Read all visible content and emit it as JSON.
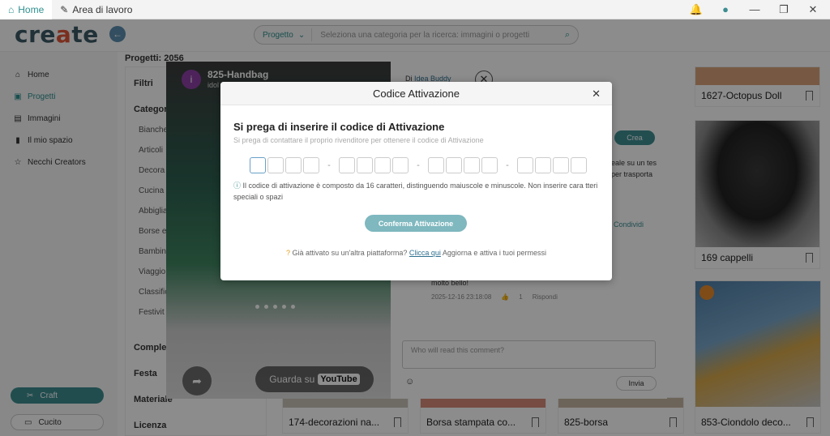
{
  "titlebar": {
    "tab_home": "Home",
    "tab_workspace": "Area di lavoro"
  },
  "header": {
    "logo_main": "cre",
    "logo_accent": "a",
    "logo_end": "te",
    "search_category": "Progetto",
    "search_placeholder": "Seleziona una categoria per la ricerca: immagini o progetti"
  },
  "sidebar": {
    "items": [
      {
        "label": "Home",
        "icon": "home-icon"
      },
      {
        "label": "Progetti",
        "icon": "projects-icon"
      },
      {
        "label": "Immagini",
        "icon": "images-icon"
      },
      {
        "label": "Il mio spazio",
        "icon": "lock-icon"
      },
      {
        "label": "Necchi Creators",
        "icon": "star-icon"
      }
    ],
    "craft_label": "Craft",
    "cucito_label": "Cucito"
  },
  "content": {
    "projects_label": "Progetti:",
    "projects_count": "2056",
    "filters_title": "Filtri",
    "category_title": "Categor",
    "categories": [
      "Bianche",
      "Articoli",
      "Decora",
      "Cucina e",
      "Abbiglia",
      "Borse e",
      "Bambin",
      "Viaggio",
      "Classific",
      "Festivit"
    ],
    "section_complex": "Comples",
    "section_festa": "Festa",
    "section_materiale": "Materiale",
    "section_licenza": "Licenza"
  },
  "cards": [
    {
      "label": "1627-Octopus Doll"
    },
    {
      "label": "169 cappelli"
    },
    {
      "label": "174-decorazioni na..."
    },
    {
      "label": "Borsa stampata co..."
    },
    {
      "label": "825-borsa"
    },
    {
      "label": "853-Ciondolo deco..."
    }
  ],
  "detail": {
    "video_title": "825-Handbag",
    "video_sub": "idol",
    "avatar_letter": "i",
    "youtube_label": "Guarda su",
    "youtube_logo": "YouTube",
    "author_prefix": "Di",
    "author": "Idea Buddy",
    "crea_label": "Crea",
    "desc_line1": "eale su un tes",
    "desc_line2": "per trasporta",
    "condividi": "Condividi",
    "comment_text": "molto bello!",
    "comment_date": "2025-12-16 23:18:08",
    "comment_likes": "1",
    "reply_label": "Rispondi",
    "comment_placeholder": "Who will read this comment?",
    "send_label": "Invia"
  },
  "modal": {
    "header": "Codice Attivazione",
    "title": "Si prega di inserire il codice di Attivazione",
    "subtitle": "Si prega di contattare il proprio rivenditore per ottenere il codice di Attivazione",
    "info": "Il codice di attivazione è composto da 16 caratteri, distinguendo maiuscole e minuscole. Non inserire cara tteri speciali o spazi",
    "confirm_label": "Conferma Attivazione",
    "note_prefix": "Già attivato su un'altra piattaforma?",
    "note_link": "Clicca qui",
    "note_suffix": "Aggiorna e attiva i tuoi permessi"
  }
}
